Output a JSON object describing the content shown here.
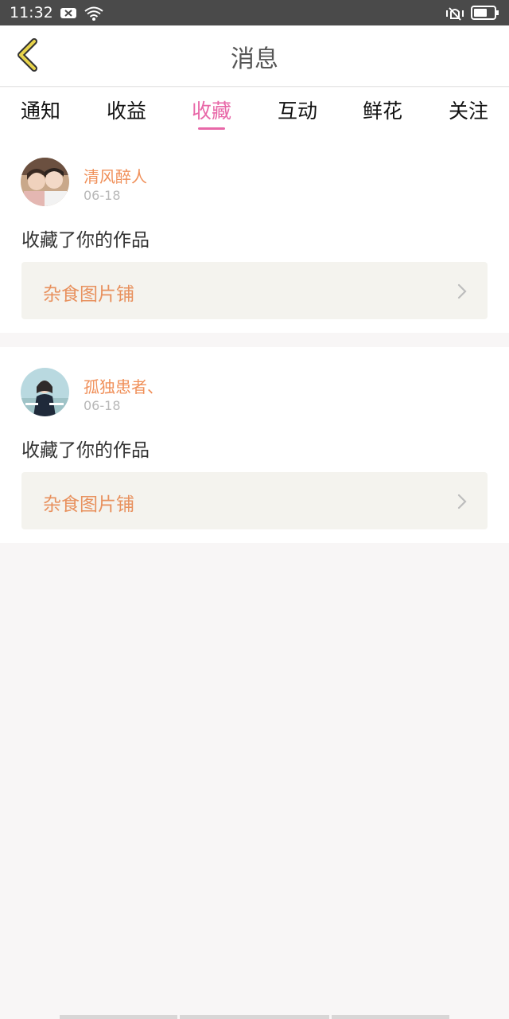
{
  "status_bar": {
    "time": "11:32",
    "icons": [
      "notification-x-icon",
      "wifi-icon",
      "vibrate-icon",
      "battery-icon"
    ]
  },
  "header": {
    "title": "消息",
    "back_icon": "chevron-left-icon"
  },
  "tabs": [
    {
      "label": "通知",
      "active": false
    },
    {
      "label": "收益",
      "active": false
    },
    {
      "label": "收藏",
      "active": true
    },
    {
      "label": "互动",
      "active": false
    },
    {
      "label": "鲜花",
      "active": false
    },
    {
      "label": "关注",
      "active": false
    }
  ],
  "messages": [
    {
      "username": "清风醉人",
      "date": "06-18",
      "action": "收藏了你的作品",
      "work_title": "杂食图片铺"
    },
    {
      "username": "孤独患者、",
      "date": "06-18",
      "action": "收藏了你的作品",
      "work_title": "杂食图片铺"
    }
  ],
  "colors": {
    "accent_pink": "#e868a8",
    "username_orange": "#f0905a",
    "work_title_orange": "#e8915e",
    "status_bar": "#4a4a4a",
    "back_arrow_yellow": "#e8d44a"
  }
}
